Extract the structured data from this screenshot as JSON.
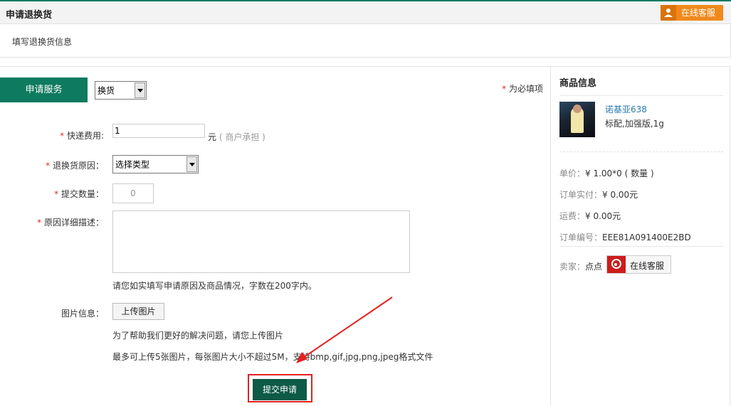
{
  "header": {
    "title": "申请退换货",
    "support_button": "在线客服"
  },
  "subheader": {
    "text": "填写退换货信息"
  },
  "form": {
    "service_label": "申请服务",
    "service_type": "换货",
    "required_note": "为必填项",
    "required_mark": "*",
    "shipping_fee": {
      "label": "快递费用:",
      "value": "1",
      "unit": "元",
      "note": "( 商户承担 )"
    },
    "reason": {
      "label": "退换货原因：",
      "selected": "选择类型"
    },
    "quantity": {
      "label": "提交数量：",
      "placeholder": "0"
    },
    "description": {
      "label": "原因详细描述：",
      "help": "请您如实填写申请原因及商品情况，字数在200字内。"
    },
    "images": {
      "label": "图片信息：",
      "upload_button": "上传图片",
      "help": "为了帮助我们更好的解决问题，请您上传图片",
      "limit_note": "最多可上传5张图片，每张图片大小不超过5M，支持bmp,gif,jpg,png,jpeg格式文件"
    },
    "submit_button": "提交申请"
  },
  "product_panel": {
    "title": "商品信息",
    "product_name": "诺基亚638",
    "product_spec": "标配,加强版,1g",
    "unit_price_label": "单价：",
    "unit_price_value": "¥ 1.00*0 ( 数量 )",
    "paid_label": "订单实付：",
    "paid_value": "¥ 0.00元",
    "shipping_label": "运费：",
    "shipping_value": "¥  0.00元",
    "order_no_label": "订单编号：",
    "order_no_value": "EEE81A091400E2BD",
    "seller_label": "卖家：",
    "seller_name": "点点",
    "support_button": "在线客服"
  },
  "colors": {
    "brand_green": "#0e7a5f",
    "submit_green": "#0d5a46",
    "orange": "#f0891c",
    "highlight_red": "#e52020",
    "link_blue": "#2a7ab0"
  }
}
